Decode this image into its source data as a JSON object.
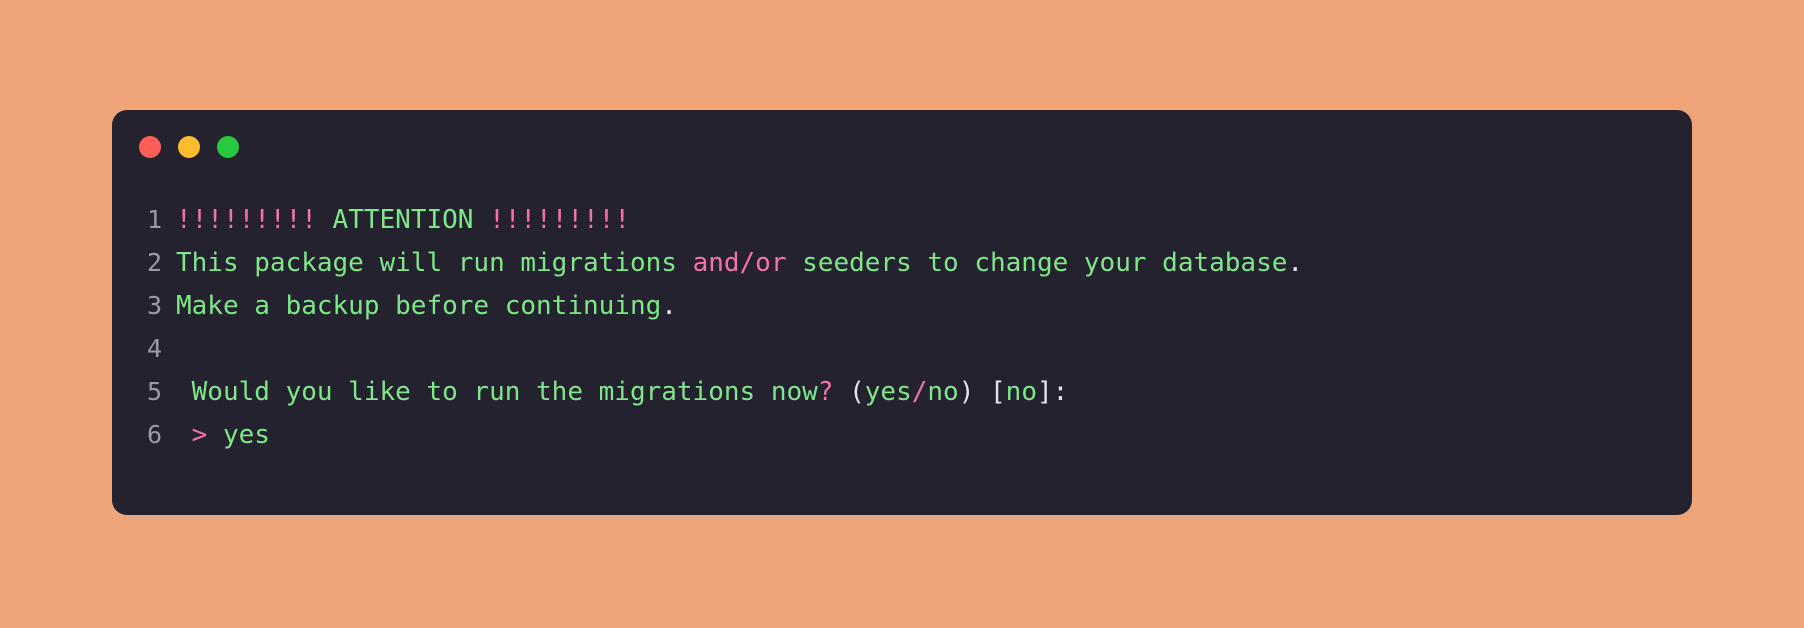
{
  "window": {
    "background_color": "#f0a47a",
    "card_color": "#24222e",
    "controls": [
      {
        "name": "close",
        "color": "#ff5f56"
      },
      {
        "name": "minimize",
        "color": "#ffbd2e"
      },
      {
        "name": "maximize",
        "color": "#27c93f"
      }
    ]
  },
  "palette": {
    "green": "#7ee787",
    "pink": "#f472a6",
    "white": "#e6e6ea",
    "gutter": "#9b9aa3"
  },
  "terminal": {
    "lines": [
      {
        "number": "1",
        "plain": "!!!!!!!!! ATTENTION !!!!!!!!!",
        "tokens": [
          {
            "text": "!!!!!!!!!",
            "color": "pink"
          },
          {
            "text": " ",
            "color": "green"
          },
          {
            "text": "ATTENTION",
            "color": "green"
          },
          {
            "text": " ",
            "color": "green"
          },
          {
            "text": "!!!!!!!!!",
            "color": "pink"
          }
        ]
      },
      {
        "number": "2",
        "plain": "This package will run migrations and/or seeders to change your database.",
        "tokens": [
          {
            "text": "This package will run migrations ",
            "color": "green"
          },
          {
            "text": "and/or",
            "color": "pink"
          },
          {
            "text": " seeders to change your database",
            "color": "green"
          },
          {
            "text": ".",
            "color": "white"
          }
        ]
      },
      {
        "number": "3",
        "plain": "Make a backup before continuing.",
        "tokens": [
          {
            "text": "Make a backup before continuing",
            "color": "green"
          },
          {
            "text": ".",
            "color": "white"
          }
        ]
      },
      {
        "number": "4",
        "plain": "",
        "tokens": []
      },
      {
        "number": "5",
        "plain": " Would you like to run the migrations now? (yes/no) [no]:",
        "tokens": [
          {
            "text": " Would you like to run the migrations now",
            "color": "green"
          },
          {
            "text": "?",
            "color": "pink"
          },
          {
            "text": " ",
            "color": "green"
          },
          {
            "text": "(",
            "color": "white"
          },
          {
            "text": "yes",
            "color": "green"
          },
          {
            "text": "/",
            "color": "pink"
          },
          {
            "text": "no",
            "color": "green"
          },
          {
            "text": ")",
            "color": "white"
          },
          {
            "text": " ",
            "color": "green"
          },
          {
            "text": "[",
            "color": "white"
          },
          {
            "text": "no",
            "color": "green"
          },
          {
            "text": "]",
            "color": "white"
          },
          {
            "text": ":",
            "color": "white"
          }
        ]
      },
      {
        "number": "6",
        "plain": " > yes",
        "tokens": [
          {
            "text": " ",
            "color": "green"
          },
          {
            "text": ">",
            "color": "pink"
          },
          {
            "text": " ",
            "color": "green"
          },
          {
            "text": "yes",
            "color": "green"
          }
        ]
      }
    ]
  }
}
